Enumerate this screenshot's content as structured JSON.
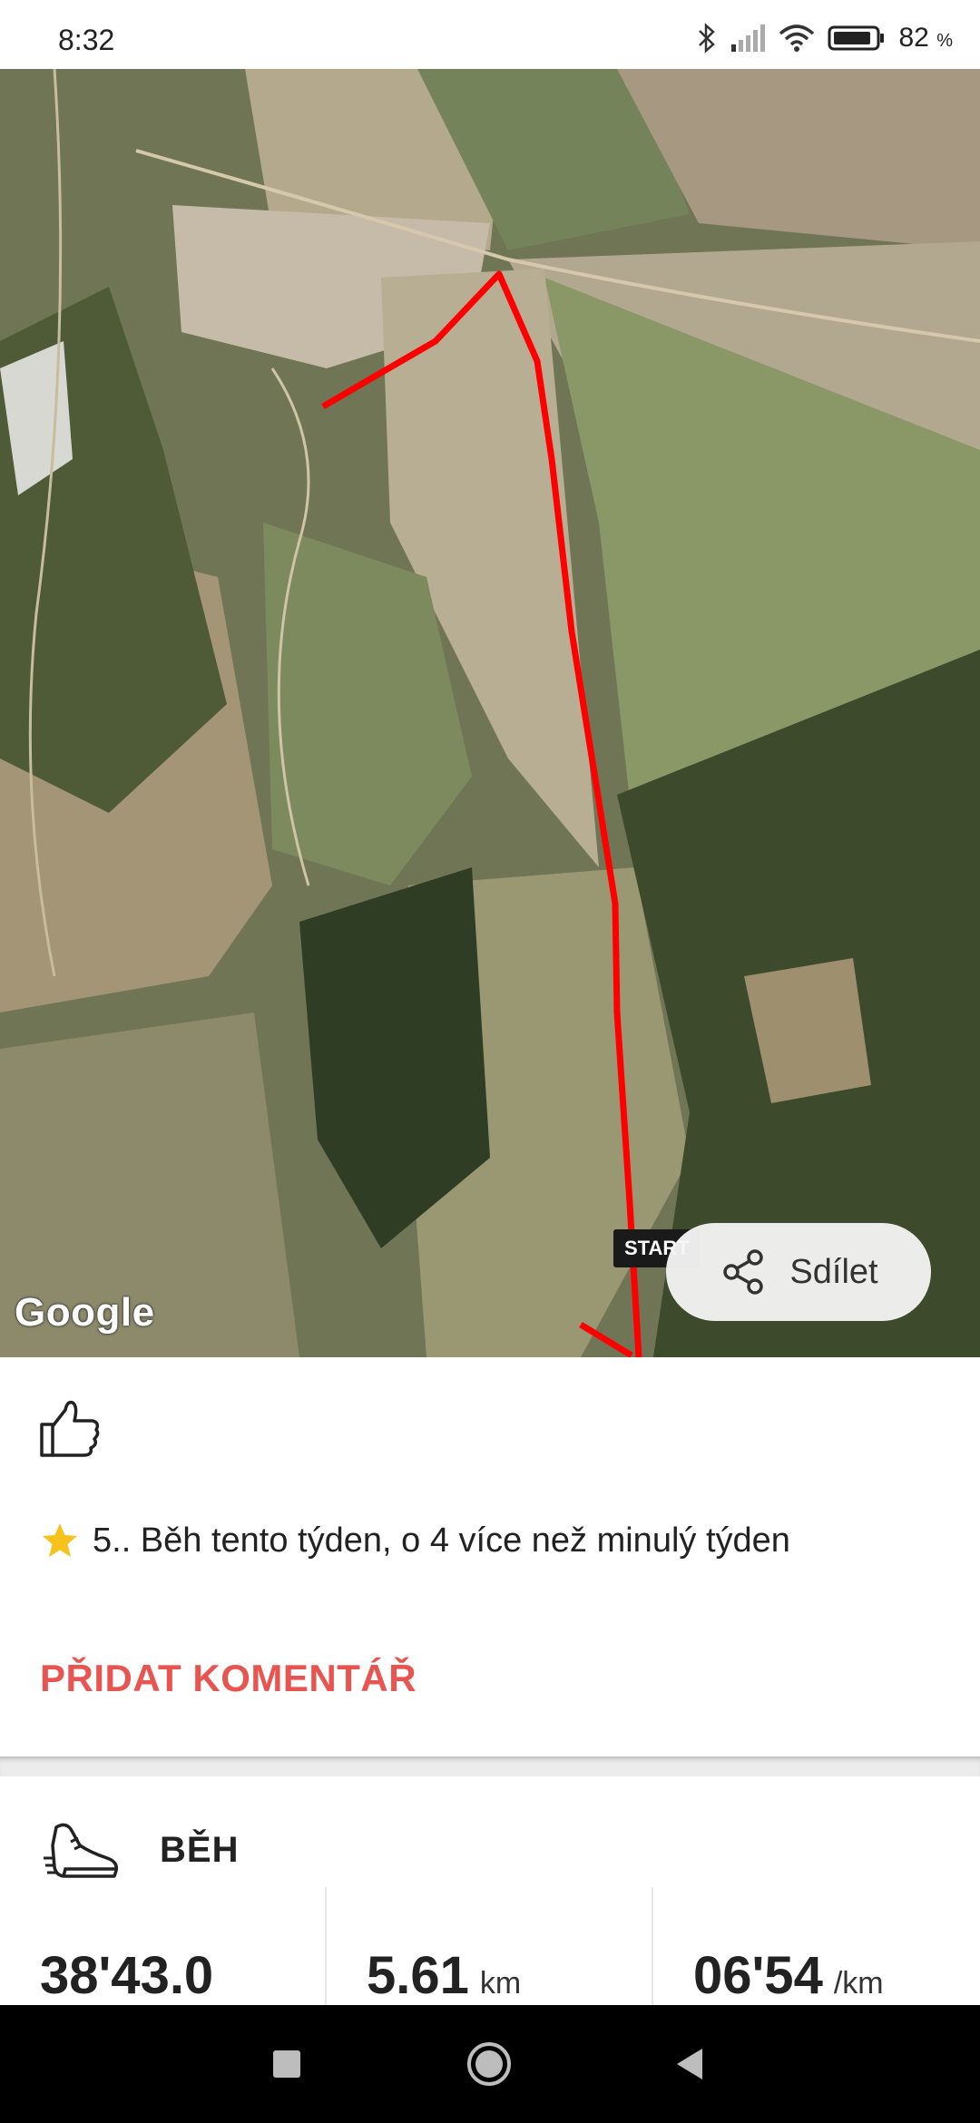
{
  "status_bar": {
    "time": "8:32",
    "battery": "82",
    "battery_unit": "%"
  },
  "map": {
    "attribution": "Google",
    "start_marker": "START",
    "share_label": "Sdílet"
  },
  "feed": {
    "achievement": "5.. Běh tento týden, o 4 více než minulý týden",
    "add_comment": "PŘIDAT KOMENTÁŘ"
  },
  "activity": {
    "type_label": "BĚH",
    "stats": [
      {
        "value": "38'43.0",
        "unit": ""
      },
      {
        "value": "5.61",
        "unit": "km"
      },
      {
        "value": "06'54",
        "unit": "/km"
      }
    ]
  },
  "colors": {
    "accent": "#e8544f",
    "route": "#ff0000"
  },
  "icons": [
    "bluetooth-icon",
    "signal-icon",
    "wifi-icon",
    "battery-icon",
    "share-icon",
    "thumbs-up-icon",
    "star-icon",
    "running-shoe-icon",
    "nav-recents-icon",
    "nav-home-icon",
    "nav-back-icon"
  ]
}
